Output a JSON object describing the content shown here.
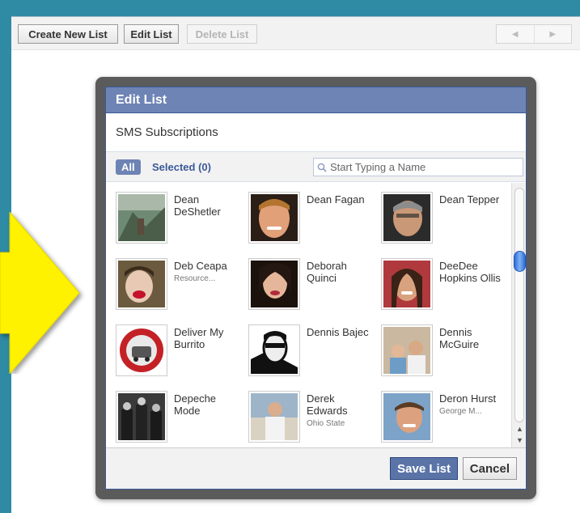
{
  "toolbar": {
    "create_label": "Create New List",
    "edit_label": "Edit List",
    "delete_label": "Delete List",
    "prev_glyph": "◀",
    "next_glyph": "▶"
  },
  "dialog": {
    "title": "Edit List",
    "list_name": "SMS Subscriptions",
    "filter_all": "All",
    "filter_selected": "Selected (0)",
    "search_placeholder": "Start Typing a Name",
    "save_label": "Save List",
    "cancel_label": "Cancel"
  },
  "scroll": {
    "up_glyph": "▲",
    "down_glyph": "▼"
  },
  "friends": [
    {
      "name": "Dean DeShetler",
      "sub": ""
    },
    {
      "name": "Dean Fagan",
      "sub": ""
    },
    {
      "name": "Dean Tepper",
      "sub": ""
    },
    {
      "name": "Deb Ceapa",
      "sub": "Resource..."
    },
    {
      "name": "Deborah Quinci",
      "sub": ""
    },
    {
      "name": "DeeDee Hopkins Ollis",
      "sub": ""
    },
    {
      "name": "Deliver My Burrito",
      "sub": ""
    },
    {
      "name": "Dennis Bajec",
      "sub": ""
    },
    {
      "name": "Dennis McGuire",
      "sub": ""
    },
    {
      "name": "Depeche Mode",
      "sub": ""
    },
    {
      "name": "Derek Edwards",
      "sub": "Ohio State"
    },
    {
      "name": "Deron Hurst",
      "sub": "George M..."
    }
  ],
  "colors": {
    "frame": "#2f8aa4",
    "header": "#6d84b4",
    "link": "#3b5998",
    "arrow": "#ffee00"
  }
}
